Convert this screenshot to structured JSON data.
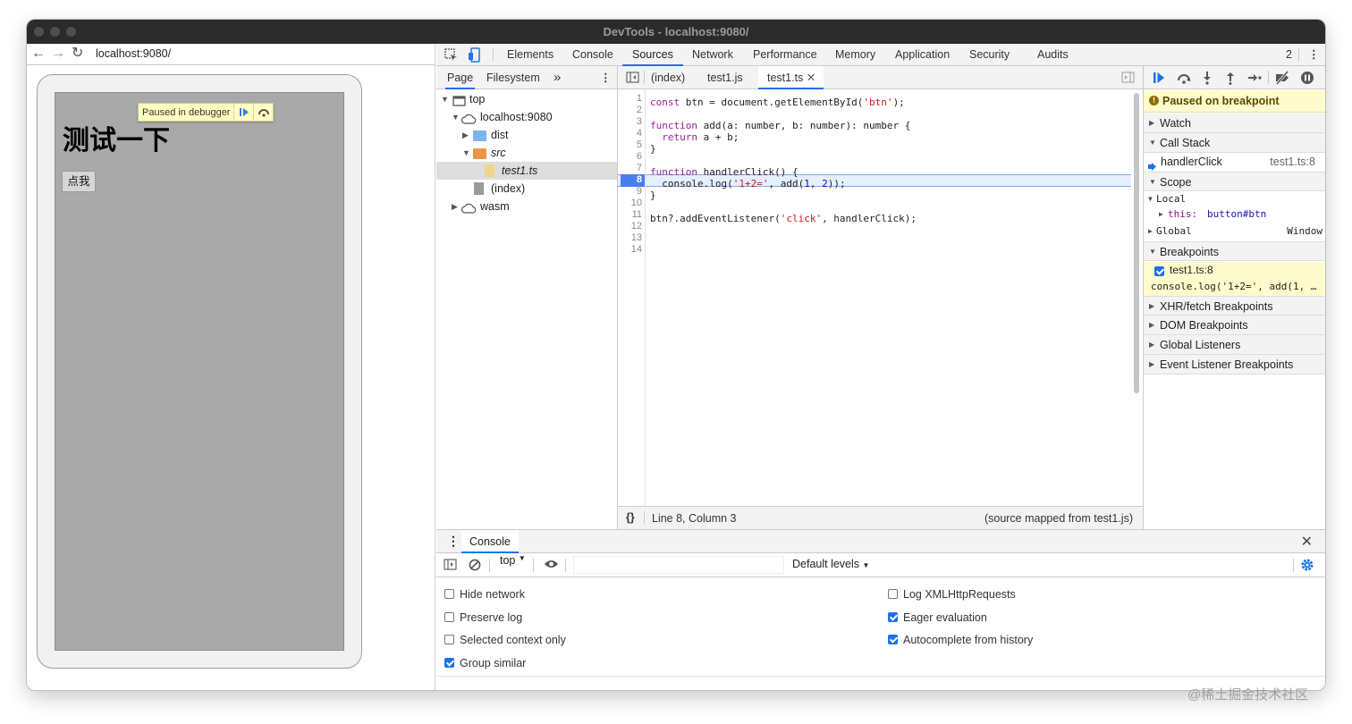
{
  "window": {
    "title": "DevTools - localhost:9080/"
  },
  "page": {
    "url": "localhost:9080/",
    "overlay_text": "Paused in debugger",
    "heading": "测试一下",
    "button_label": "点我"
  },
  "devtools": {
    "main_tabs": [
      "Elements",
      "Console",
      "Sources",
      "Network",
      "Performance",
      "Memory",
      "Application",
      "Security",
      "Audits"
    ],
    "active_tab": "Sources",
    "issues_count": "2",
    "navigator": {
      "tabs": [
        "Page",
        "Filesystem"
      ],
      "more": "»",
      "tree": [
        {
          "label": "top",
          "icon": "frame-icon"
        },
        {
          "label": "localhost:9080",
          "icon": "cloud-icon"
        },
        {
          "label": "dist",
          "icon": "folder-icon"
        },
        {
          "label": "src",
          "icon": "folder-icon"
        },
        {
          "label": "test1.ts",
          "icon": "file-icon"
        },
        {
          "label": "(index)",
          "icon": "file-icon"
        },
        {
          "label": "wasm",
          "icon": "cloud-icon"
        }
      ]
    },
    "editor": {
      "tabs": [
        "(index)",
        "test1.js",
        "test1.ts"
      ],
      "active_tab": "test1.ts",
      "current_line": 8,
      "status_position": "Line 8, Column 3",
      "status_source": "(source mapped from test1.js)",
      "pretty_print": "{}",
      "lines": [
        "const btn = document.getElementById('btn');",
        "",
        "function add(a: number, b: number): number {",
        "  return a + b;",
        "}",
        "",
        "function handlerClick() {",
        "  console.log('1+2=', add(1, 2));",
        "}",
        "",
        "btn?.addEventListener('click', handlerClick);",
        "",
        "",
        ""
      ]
    },
    "debugger": {
      "paused_message": "Paused on breakpoint",
      "sections": {
        "watch": "Watch",
        "call_stack": "Call Stack",
        "scope": "Scope",
        "breakpoints": "Breakpoints",
        "xhr": "XHR/fetch Breakpoints",
        "dom": "DOM Breakpoints",
        "global_listeners": "Global Listeners",
        "event_listener": "Event Listener Breakpoints"
      },
      "call_stack_frame": {
        "name": "handlerClick",
        "location": "test1.ts:8"
      },
      "scope": {
        "local": "Local",
        "this_key": "this:",
        "this_value": "button#btn",
        "global": "Global",
        "global_value": "Window"
      },
      "breakpoint": {
        "label": "test1.ts:8",
        "code": "console.log('1+2=', add(1, …",
        "checked": true
      }
    },
    "console": {
      "tab_label": "Console",
      "context": "top",
      "levels": "Default levels",
      "options_left": [
        {
          "label": "Hide network",
          "checked": false
        },
        {
          "label": "Preserve log",
          "checked": false
        },
        {
          "label": "Selected context only",
          "checked": false
        },
        {
          "label": "Group similar",
          "checked": true
        }
      ],
      "options_right": [
        {
          "label": "Log XMLHttpRequests",
          "checked": false
        },
        {
          "label": "Eager evaluation",
          "checked": true
        },
        {
          "label": "Autocomplete from history",
          "checked": true
        }
      ]
    }
  },
  "watermark": "@稀土掘金技术社区",
  "colors": {
    "accent": "#1a73e8",
    "paused_bg": "#fffbcc",
    "exec_line": "#e5efff",
    "breakpoint": "#4a7ef0"
  }
}
